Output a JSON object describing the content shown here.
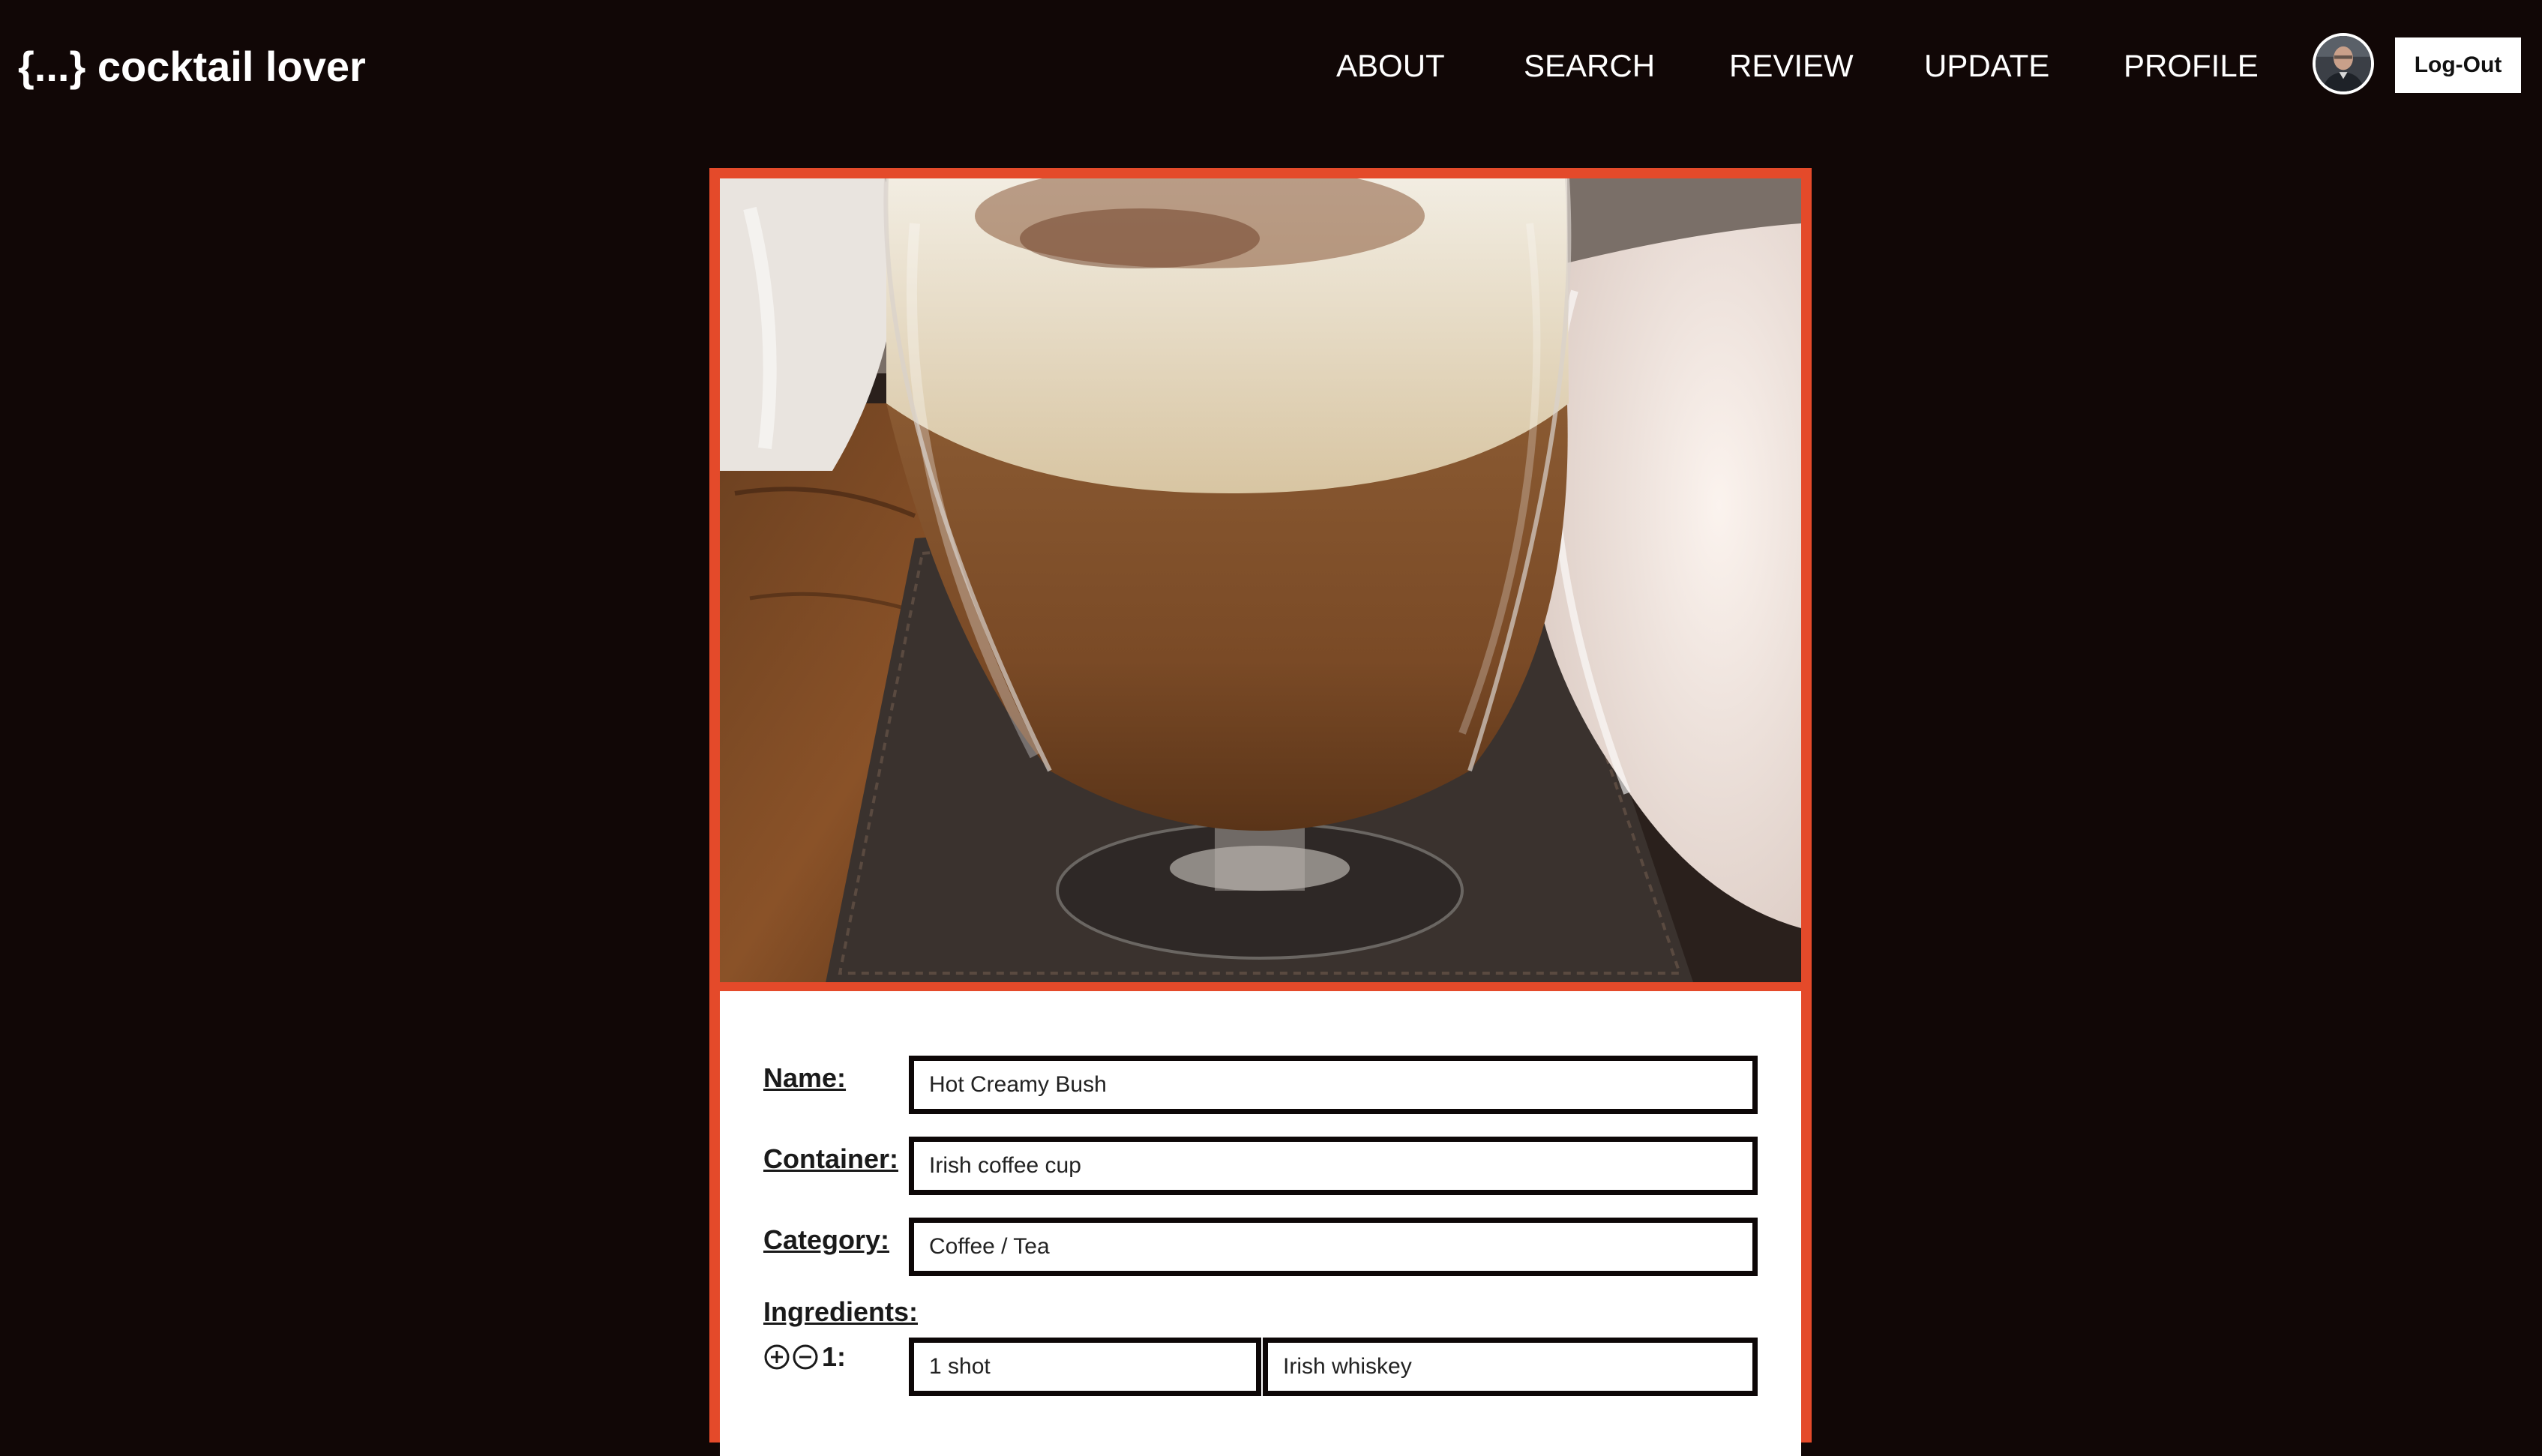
{
  "header": {
    "brand": "{...} cocktail lover",
    "nav": {
      "about": "ABOUT",
      "search": "SEARCH",
      "review": "REVIEW",
      "update": "UPDATE",
      "profile": "PROFILE"
    },
    "logout_label": "Log-Out"
  },
  "form": {
    "name_label": "Name:",
    "name_value": "Hot Creamy Bush",
    "container_label": "Container:",
    "container_value": "Irish coffee cup",
    "category_label": "Category:",
    "category_value": "Coffee / Tea",
    "ingredients_label": "Ingredients:",
    "ingredients": [
      {
        "index": "1:",
        "amount": "1 shot",
        "name": "Irish whiskey"
      }
    ]
  },
  "colors": {
    "background": "#110706",
    "card_border": "#e44a2a",
    "field_border": "#0d0707"
  }
}
